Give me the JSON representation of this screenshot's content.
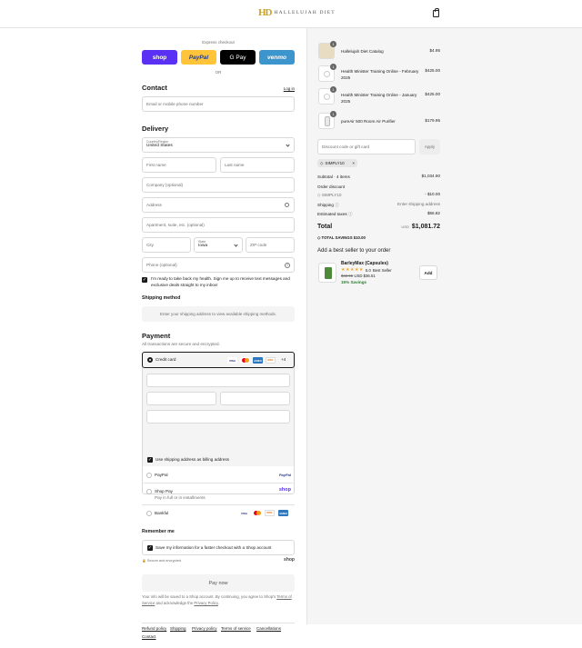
{
  "brand": {
    "mark": "HD",
    "name": "HALLELUJAH DIET"
  },
  "express": {
    "label": "Express checkout",
    "shop": "shop",
    "paypal": "PayPal",
    "gpay": "G Pay",
    "venmo": "venmo",
    "or": "OR"
  },
  "contact": {
    "heading": "Contact",
    "login": "Log in",
    "email_placeholder": "Email or mobile phone number"
  },
  "delivery": {
    "heading": "Delivery",
    "country_label": "Country/Region",
    "country_value": "United States",
    "first_name": "First name",
    "last_name": "Last name",
    "company": "Company (optional)",
    "address": "Address",
    "apartment": "Apartment, suite, etc. (optional)",
    "city": "City",
    "state_label": "State",
    "state_value": "Iowa",
    "zip": "ZIP code",
    "phone": "Phone (optional)",
    "sms_text": "I'm ready to take back my health. Sign me up to receive text messages and exclusive deals straight to my inbox!"
  },
  "shipping_method": {
    "heading": "Shipping method",
    "notice": "Enter your shipping address to view available shipping methods."
  },
  "payment": {
    "heading": "Payment",
    "subtitle": "All transactions are secure and encrypted.",
    "credit_card": "Credit card",
    "more_cards": "+4",
    "billing_same": "Use shipping address as billing address",
    "paypal": "PayPal",
    "paypal_logo": "PayPal",
    "shop_pay": "Shop Pay",
    "shop_pay_sub": "Pay in full or in installments",
    "shop_logo": "shop",
    "bankful": "Bankful",
    "card_brands": [
      "VISA",
      "MC",
      "AMEX",
      "DISC"
    ]
  },
  "remember": {
    "heading": "Remember me",
    "save_text": "Save my information for a faster checkout with a Shop account",
    "secure": "Secure and encrypted",
    "shop": "shop"
  },
  "pay_now": "Pay now",
  "legal": {
    "line1": "Your info will be saved to a Shop account. By continuing, you agree to Shop's",
    "tos": "Terms of Service",
    "and": "and acknowledge the",
    "privacy": "Privacy Policy",
    "period": "."
  },
  "footer": {
    "links": [
      "Refund policy",
      "Shipping",
      "Privacy policy",
      "Terms of service",
      "Cancellations"
    ],
    "contact": "Contact"
  },
  "cart": {
    "items": [
      {
        "qty": "1",
        "name": "Hallelujah Diet Catalog",
        "price": "$4.95"
      },
      {
        "qty": "1",
        "name": "Health Minister Training Online - February 2025",
        "price": "$425.00"
      },
      {
        "qty": "1",
        "name": "Health Minister Training Online - January 2025",
        "price": "$425.00"
      },
      {
        "qty": "1",
        "name": "pureAir 500 Room Air Purifier",
        "price": "$179.95"
      }
    ],
    "discount_placeholder": "Discount code or gift card",
    "apply": "Apply",
    "code_tag": "SIMPLY10",
    "subtotal_label": "Subtotal · 4 items",
    "subtotal": "$1,034.90",
    "order_discount": "Order discount",
    "discount_code": "SIMPLY10",
    "discount_value": "- $10.00",
    "shipping_label": "Shipping",
    "shipping_value": "Enter shipping address",
    "taxes_label": "Estimated taxes",
    "taxes_value": "$56.82",
    "total_label": "Total",
    "currency": "USD",
    "total": "$1,081.72",
    "savings_label": "TOTAL SAVINGS",
    "savings": "$10.00"
  },
  "upsell": {
    "heading": "Add a best seller to your order",
    "name": "BarleyMax (Capsules)",
    "rating": "5.0",
    "badge": "Best Seller",
    "old_price": "$42.95",
    "new_price": "USD $36.51",
    "save": "15% Savings",
    "add": "Add"
  },
  "colors": {
    "shop": "#5a31f4",
    "paypal": "#ffc439",
    "gpay": "#000000",
    "venmo": "#3d95ce",
    "green": "#2e7d32",
    "gold": "#c9a227"
  }
}
